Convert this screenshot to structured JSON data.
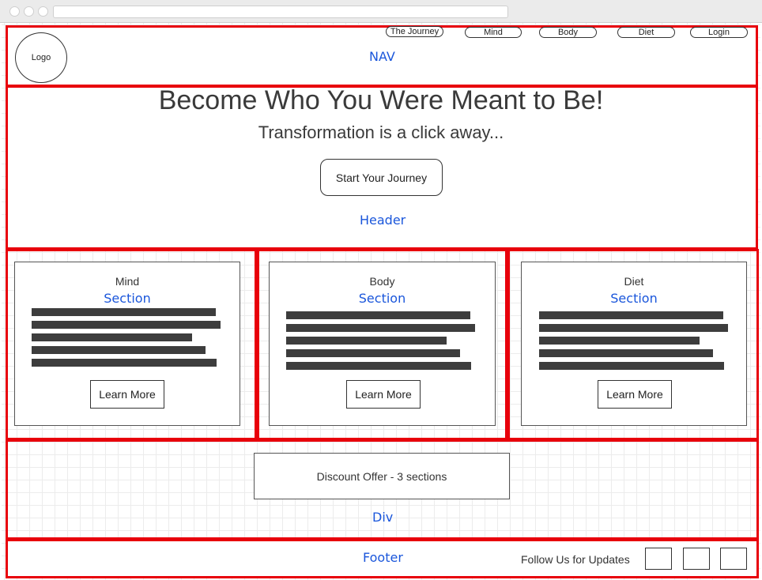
{
  "nav": {
    "logo_label": "Logo",
    "links": [
      "The Journey",
      "Mind",
      "Body",
      "Diet",
      "Login"
    ],
    "region_label": "NAV"
  },
  "header": {
    "title": "Become Who You Were Meant to Be!",
    "subtitle": "Transformation is a click away...",
    "cta_label": "Start Your Journey",
    "region_label": "Header"
  },
  "sections": [
    {
      "title": "Mind",
      "region_label": "Section",
      "button_label": "Learn More"
    },
    {
      "title": "Body",
      "region_label": "Section",
      "button_label": "Learn More"
    },
    {
      "title": "Diet",
      "region_label": "Section",
      "button_label": "Learn More"
    }
  ],
  "div": {
    "offer_label": "Discount Offer - 3 sections",
    "region_label": "Div"
  },
  "footer": {
    "region_label": "Footer",
    "follow_label": "Follow Us for Updates"
  },
  "colors": {
    "frame": "#e8000b",
    "annotation": "#1a56db",
    "text_bar": "#3d3d3d"
  }
}
